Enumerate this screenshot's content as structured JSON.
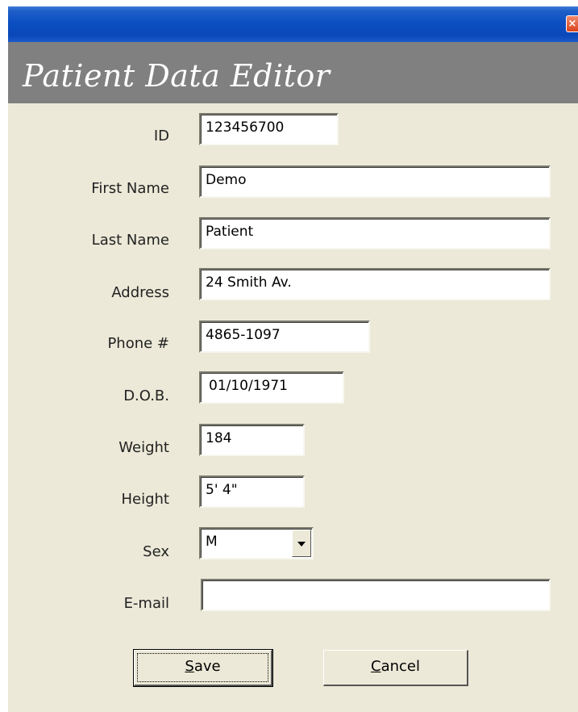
{
  "window": {
    "close_glyph": "×"
  },
  "header": {
    "title": "Patient Data Editor"
  },
  "form": {
    "id": {
      "label": "ID",
      "value": "123456700"
    },
    "first_name": {
      "label": "First Name",
      "value": "Demo"
    },
    "last_name": {
      "label": "Last Name",
      "value": "Patient"
    },
    "address": {
      "label": "Address",
      "value": "24 Smith Av."
    },
    "phone": {
      "label": "Phone #",
      "value": "4865-1097"
    },
    "dob": {
      "label": "D.O.B.",
      "value": "01/10/1971"
    },
    "weight": {
      "label": "Weight",
      "value": "184"
    },
    "height": {
      "label": "Height",
      "value": "5' 4\""
    },
    "sex": {
      "label": "Sex",
      "value": "M"
    },
    "email": {
      "label": "E-mail",
      "value": ""
    }
  },
  "buttons": {
    "save": {
      "accel": "S",
      "rest": "ave"
    },
    "cancel": {
      "accel": "C",
      "rest": "ancel"
    }
  },
  "colors": {
    "dialog_background": "#ece9d8",
    "header_band": "#808080",
    "titlebar": "#0b4fc2"
  }
}
